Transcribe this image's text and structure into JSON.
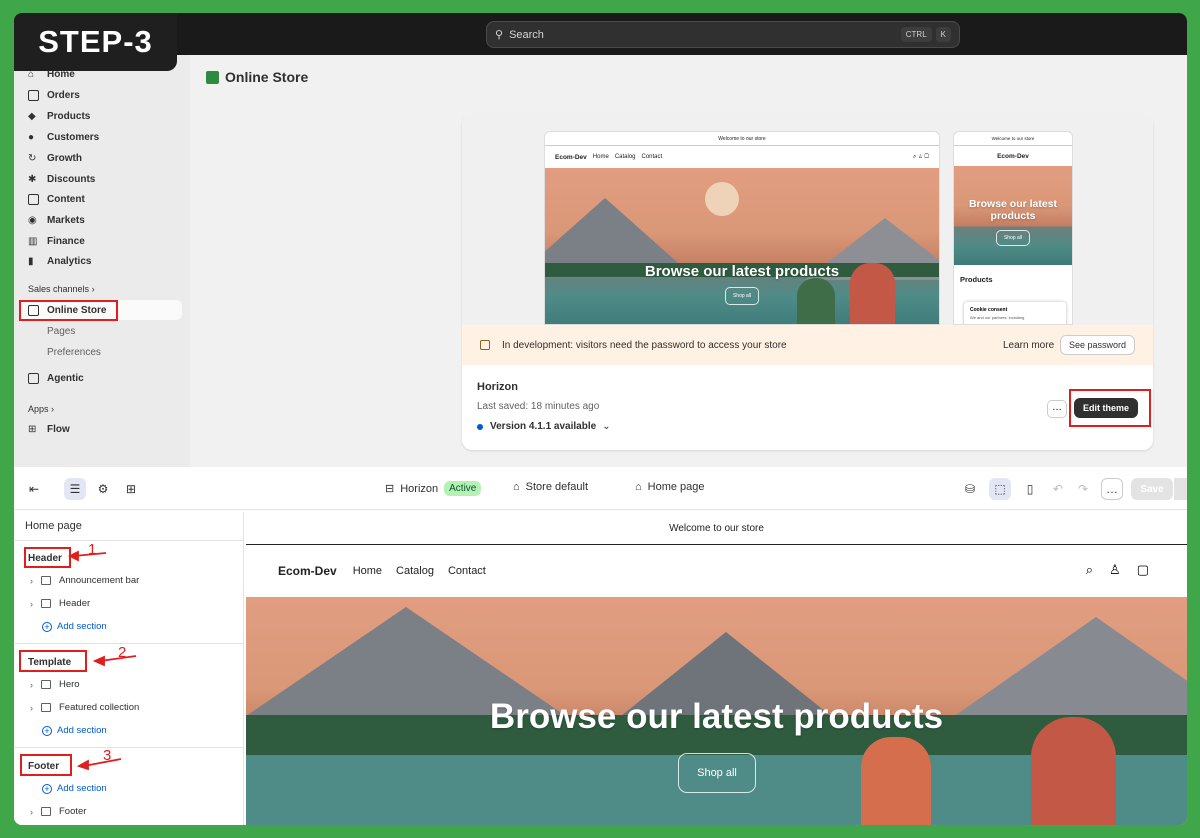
{
  "step_label": "STEP-3",
  "search": {
    "placeholder": "Search",
    "keys": [
      "CTRL",
      "K"
    ]
  },
  "sidebar": {
    "items": [
      {
        "label": "Home",
        "icon": "home-icon"
      },
      {
        "label": "Orders",
        "icon": "inbox-icon"
      },
      {
        "label": "Products",
        "icon": "tag-icon"
      },
      {
        "label": "Customers",
        "icon": "person-icon"
      },
      {
        "label": "Growth",
        "icon": "growth-icon"
      },
      {
        "label": "Discounts",
        "icon": "discount-icon"
      },
      {
        "label": "Content",
        "icon": "content-icon"
      },
      {
        "label": "Markets",
        "icon": "globe-icon"
      },
      {
        "label": "Finance",
        "icon": "bank-icon"
      },
      {
        "label": "Analytics",
        "icon": "chart-icon"
      }
    ],
    "sales_channels": "Sales channels",
    "online_store": "Online Store",
    "sub_items": [
      "Pages",
      "Preferences"
    ],
    "agentic": "Agentic",
    "apps": "Apps",
    "flow": "Flow"
  },
  "main": {
    "title": "Online Store",
    "preview": {
      "announcement": "Welcome to our store",
      "brand": "Ecom-Dev",
      "nav": [
        "Home",
        "Catalog",
        "Contact"
      ],
      "hero_text": "Browse our latest products",
      "shop_all": "Shop all",
      "mobile_hero": "Browse our latest products",
      "products_heading": "Products",
      "cookie_title": "Cookie consent",
      "cookie_text": "We and our partners, including"
    },
    "dev_notice": "In development: visitors need the password to access your store",
    "learn_more": "Learn more",
    "see_password": "See password",
    "theme_name": "Horizon",
    "last_saved": "Last saved: 18 minutes ago",
    "version": "Version 4.1.1 available",
    "edit_theme": "Edit theme"
  },
  "editor": {
    "theme": "Horizon",
    "status": "Active",
    "store": "Store default",
    "page": "Home page",
    "save": "Save",
    "panel_title": "Home page",
    "groups": {
      "header": "Header",
      "template": "Template",
      "footer": "Footer"
    },
    "header_rows": [
      "Announcement bar",
      "Header"
    ],
    "template_rows": [
      "Hero",
      "Featured collection"
    ],
    "footer_rows": [
      "Footer"
    ],
    "add_section": "Add section",
    "annotations": [
      "1",
      "2",
      "3"
    ],
    "canvas": {
      "announcement": "Welcome to our store",
      "brand": "Ecom-Dev",
      "nav": [
        "Home",
        "Catalog",
        "Contact"
      ],
      "hero_text": "Browse our latest products",
      "shop_all": "Shop all"
    }
  }
}
